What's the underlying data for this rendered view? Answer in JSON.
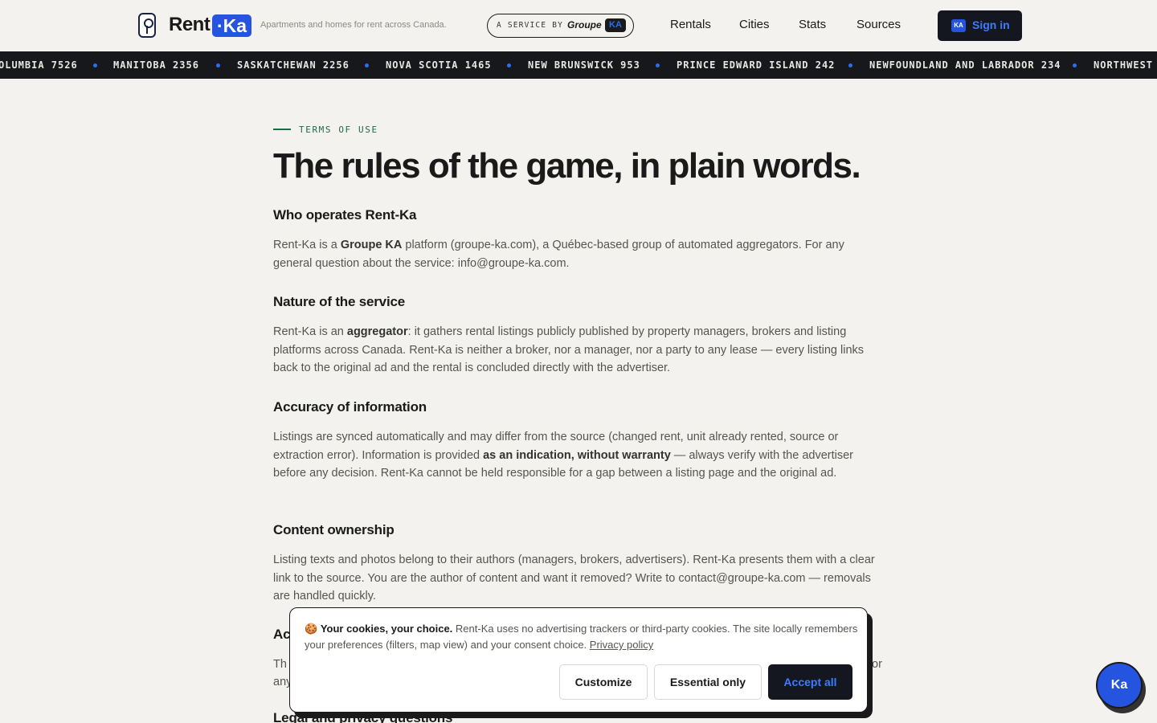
{
  "header": {
    "logo_text": "Rent",
    "logo_badge": "·Ka",
    "tagline": "Apartments and homes for rent across Canada.",
    "service_prefix": "A SERVICE BY",
    "service_brand": "Groupe",
    "service_badge": "KA",
    "nav": [
      "Rentals",
      "Cities",
      "Stats",
      "Sources"
    ],
    "signin_badge": "KA",
    "signin_label": "Sign in"
  },
  "ticker": [
    "OLUMBIA 7526",
    "MANITOBA 2356",
    "SASKATCHEWAN 2256",
    "NOVA SCOTIA 1465",
    "NEW BRUNSWICK 953",
    "PRINCE EDWARD ISLAND 242",
    "NEWFOUNDLAND AND LABRADOR 234",
    "NORTHWEST"
  ],
  "colors": {
    "accent": "#2554e0",
    "eyebrow": "#1f6b45",
    "dark": "#14171f",
    "background": "#f3f2ee"
  },
  "page": {
    "eyebrow": "TERMS OF USE",
    "title": "The rules of the game, in plain words.",
    "sections": [
      {
        "heading": "Who operates Rent-Ka",
        "p1": "Rent-Ka is a ",
        "b1": "Groupe KA",
        "p2": " platform (groupe-ka.com), a Québec-based group of automated aggregators. For any general question about the service: info@groupe-ka.com."
      },
      {
        "heading": "Nature of the service",
        "p1": "Rent-Ka is an ",
        "b1": "aggregator",
        "p2": ": it gathers rental listings publicly published by property managers, brokers and listing platforms across Canada. Rent-Ka is neither a broker, nor a manager, nor a party to any lease — every listing links back to the original ad and the rental is concluded directly with the advertiser."
      },
      {
        "heading": "Accuracy of information",
        "p1": "Listings are synced automatically and may differ from the source (changed rent, unit already rented, source or extraction error). Information is provided ",
        "b1": "as an indication, without warranty",
        "p2": " — always verify with the advertiser before any decision. Rent-Ka cannot be held responsible for a gap between a listing page and the original ad."
      },
      {
        "heading": "Content ownership",
        "text": "Listing texts and photos belong to their authors (managers, brokers, advertisers). Rent-Ka presents them with a clear link to the source. You are the author of content and want it removed? Write to contact@groupe-ka.com — removals are handled quickly."
      },
      {
        "heading": "Ac",
        "text_l1": "Th",
        "text_l1_end": "or",
        "text_l2": "any"
      },
      {
        "heading": "Legal and privacy questions"
      }
    ]
  },
  "cookie": {
    "emoji": "🍪",
    "title": "Your cookies, your choice.",
    "text": " Rent-Ka uses no advertising trackers or third-party cookies. The site locally remembers your preferences (filters, map view) and your consent choice. ",
    "link": "Privacy policy",
    "customize": "Customize",
    "essential": "Essential only",
    "accept": "Accept all"
  },
  "fab_label": "Ka"
}
